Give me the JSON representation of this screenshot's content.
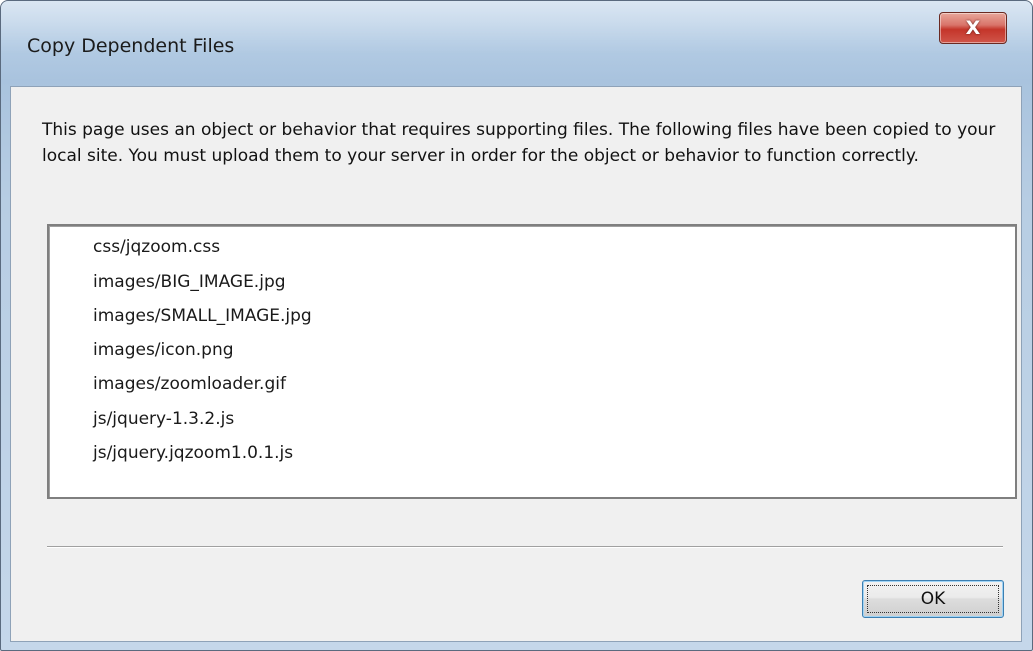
{
  "window": {
    "title": "Copy Dependent Files",
    "close_glyph": "X"
  },
  "dialog": {
    "message": "This page uses an object or behavior that requires supporting files. The following files have been copied to your local site. You must upload them to your server in order for the object or behavior to function correctly.",
    "files": [
      "css/jqzoom.css",
      "images/BIG_IMAGE.jpg",
      "images/SMALL_IMAGE.jpg",
      "images/icon.png",
      "images/zoomloader.gif",
      "js/jquery-1.3.2.js",
      "js/jquery.jqzoom1.0.1.js"
    ],
    "ok_label": "OK"
  },
  "icons": {
    "close": "close-icon"
  },
  "colors": {
    "close_button": "#c4352a",
    "ok_border": "#3c7fb1",
    "client_bg": "#f0f0f0"
  }
}
